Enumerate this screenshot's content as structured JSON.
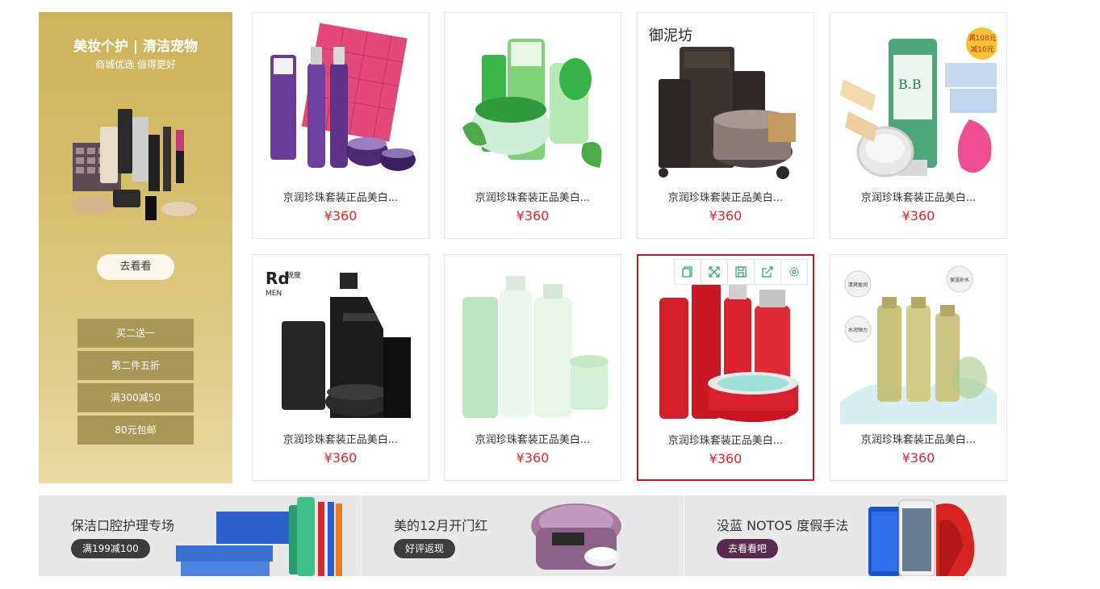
{
  "promo": {
    "title": "美妆个护 | 清洁宠物",
    "subtitle": "商城优选 值得更好",
    "cta": "去看看",
    "tags": [
      "买二送一",
      "第二件五折",
      "满300减50",
      "80元包邮"
    ]
  },
  "products": [
    {
      "name": "京润珍珠套装正品美白...",
      "price": "¥360",
      "image": "zmc-purple-gift-set"
    },
    {
      "name": "京润珍珠套装正品美白...",
      "price": "¥360",
      "image": "cathy-green-skincare"
    },
    {
      "name": "京润珍珠套装正品美白...",
      "price": "¥360",
      "image": "yunifang-mud-mask",
      "brand": "御泥坊"
    },
    {
      "name": "京润珍珠套装正品美白...",
      "price": "¥360",
      "image": "bb-cream-set",
      "badge": [
        "满108元",
        "减10元"
      ]
    },
    {
      "name": "京润珍珠套装正品美白...",
      "price": "¥360",
      "image": "rd-men-black-set",
      "brand": "锐度",
      "brand_sub": "MEN"
    },
    {
      "name": "京润珍珠套装正品美白...",
      "price": "¥360",
      "image": "pure-mild-green-set"
    },
    {
      "name": "京润珍珠套装正品美白...",
      "price": "¥360",
      "image": "red-skincare-set"
    },
    {
      "name": "京润珍珠套装正品美白...",
      "price": "¥360",
      "image": "ginkgo-splash-set",
      "bubbles": [
        "清爽盈润",
        "保湿补水",
        "水润弹力"
      ]
    }
  ],
  "selected_index": 6,
  "toolbar_icons": [
    "copy-icon",
    "expand-icon",
    "save-icon",
    "share-icon",
    "settings-icon"
  ],
  "banners": [
    {
      "title": "保洁口腔护理专场",
      "pill": "满199减100",
      "pill_color": "#3c3c3c",
      "image": "toothpaste-set"
    },
    {
      "title": "美的12月开门红",
      "pill": "好评返现",
      "pill_color": "#3d3d3d",
      "image": "rice-cooker"
    },
    {
      "title": "没蓝 NOTO5 度假手法",
      "pill": "去看看吧",
      "pill_color": "#5a2a4e",
      "image": "smartphones"
    }
  ],
  "colors": {
    "price": "#e4262f",
    "selected_border": "#b41d23",
    "promo_gold": "#cdb35a",
    "toolbar_green": "#25a267"
  }
}
